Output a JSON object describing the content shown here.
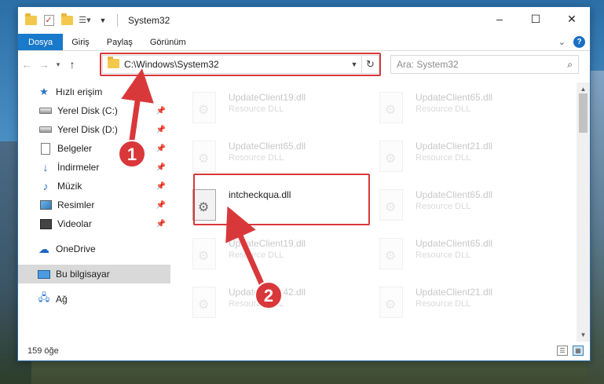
{
  "window": {
    "title": "System32",
    "controls": {
      "minimize": "–",
      "maximize": "☐",
      "close": "✕"
    }
  },
  "ribbon": {
    "tabs": [
      {
        "label": "Dosya",
        "active": true
      },
      {
        "label": "Giriş",
        "active": false
      },
      {
        "label": "Paylaş",
        "active": false
      },
      {
        "label": "Görünüm",
        "active": false
      }
    ],
    "help": "?"
  },
  "address": {
    "path": "C:\\Windows\\System32",
    "search_placeholder": "Ara: System32"
  },
  "nav": {
    "quick_access": "Hızlı erişim",
    "items": [
      {
        "label": "Yerel Disk (C:)",
        "icon": "drive-icon"
      },
      {
        "label": "Yerel Disk (D:)",
        "icon": "drive-icon"
      },
      {
        "label": "Belgeler",
        "icon": "documents-icon"
      },
      {
        "label": "İndirmeler",
        "icon": "downloads-icon"
      },
      {
        "label": "Müzik",
        "icon": "music-icon"
      },
      {
        "label": "Resimler",
        "icon": "pictures-icon"
      },
      {
        "label": "Videolar",
        "icon": "videos-icon"
      }
    ],
    "onedrive": "OneDrive",
    "this_pc": "Bu bilgisayar",
    "network": "Ağ"
  },
  "files": {
    "left": [
      {
        "name": "UpdateClient19.dll",
        "type": "Resource DLL"
      },
      {
        "name": "UpdateClient65.dll",
        "type": "Resource DLL"
      },
      {
        "name": "intcheckqua.dll",
        "type": ""
      },
      {
        "name": "UpdateClient19.dll",
        "type": "Resource DLL"
      },
      {
        "name": "UpdateClient42.dll",
        "type": "Resource DLL"
      }
    ],
    "right": [
      {
        "name": "UpdateClient65.dll",
        "type": "Resource DLL"
      },
      {
        "name": "UpdateClient21.dll",
        "type": "Resource DLL"
      },
      {
        "name": "UpdateClient65.dll",
        "type": "Resource DLL"
      },
      {
        "name": "UpdateClient65.dll",
        "type": "Resource DLL"
      },
      {
        "name": "UpdateClient21.dll",
        "type": "Resource DLL"
      }
    ]
  },
  "status": {
    "count": "159 öğe"
  },
  "annotations": {
    "step1": "1",
    "step2": "2",
    "color": "#d9383a"
  }
}
